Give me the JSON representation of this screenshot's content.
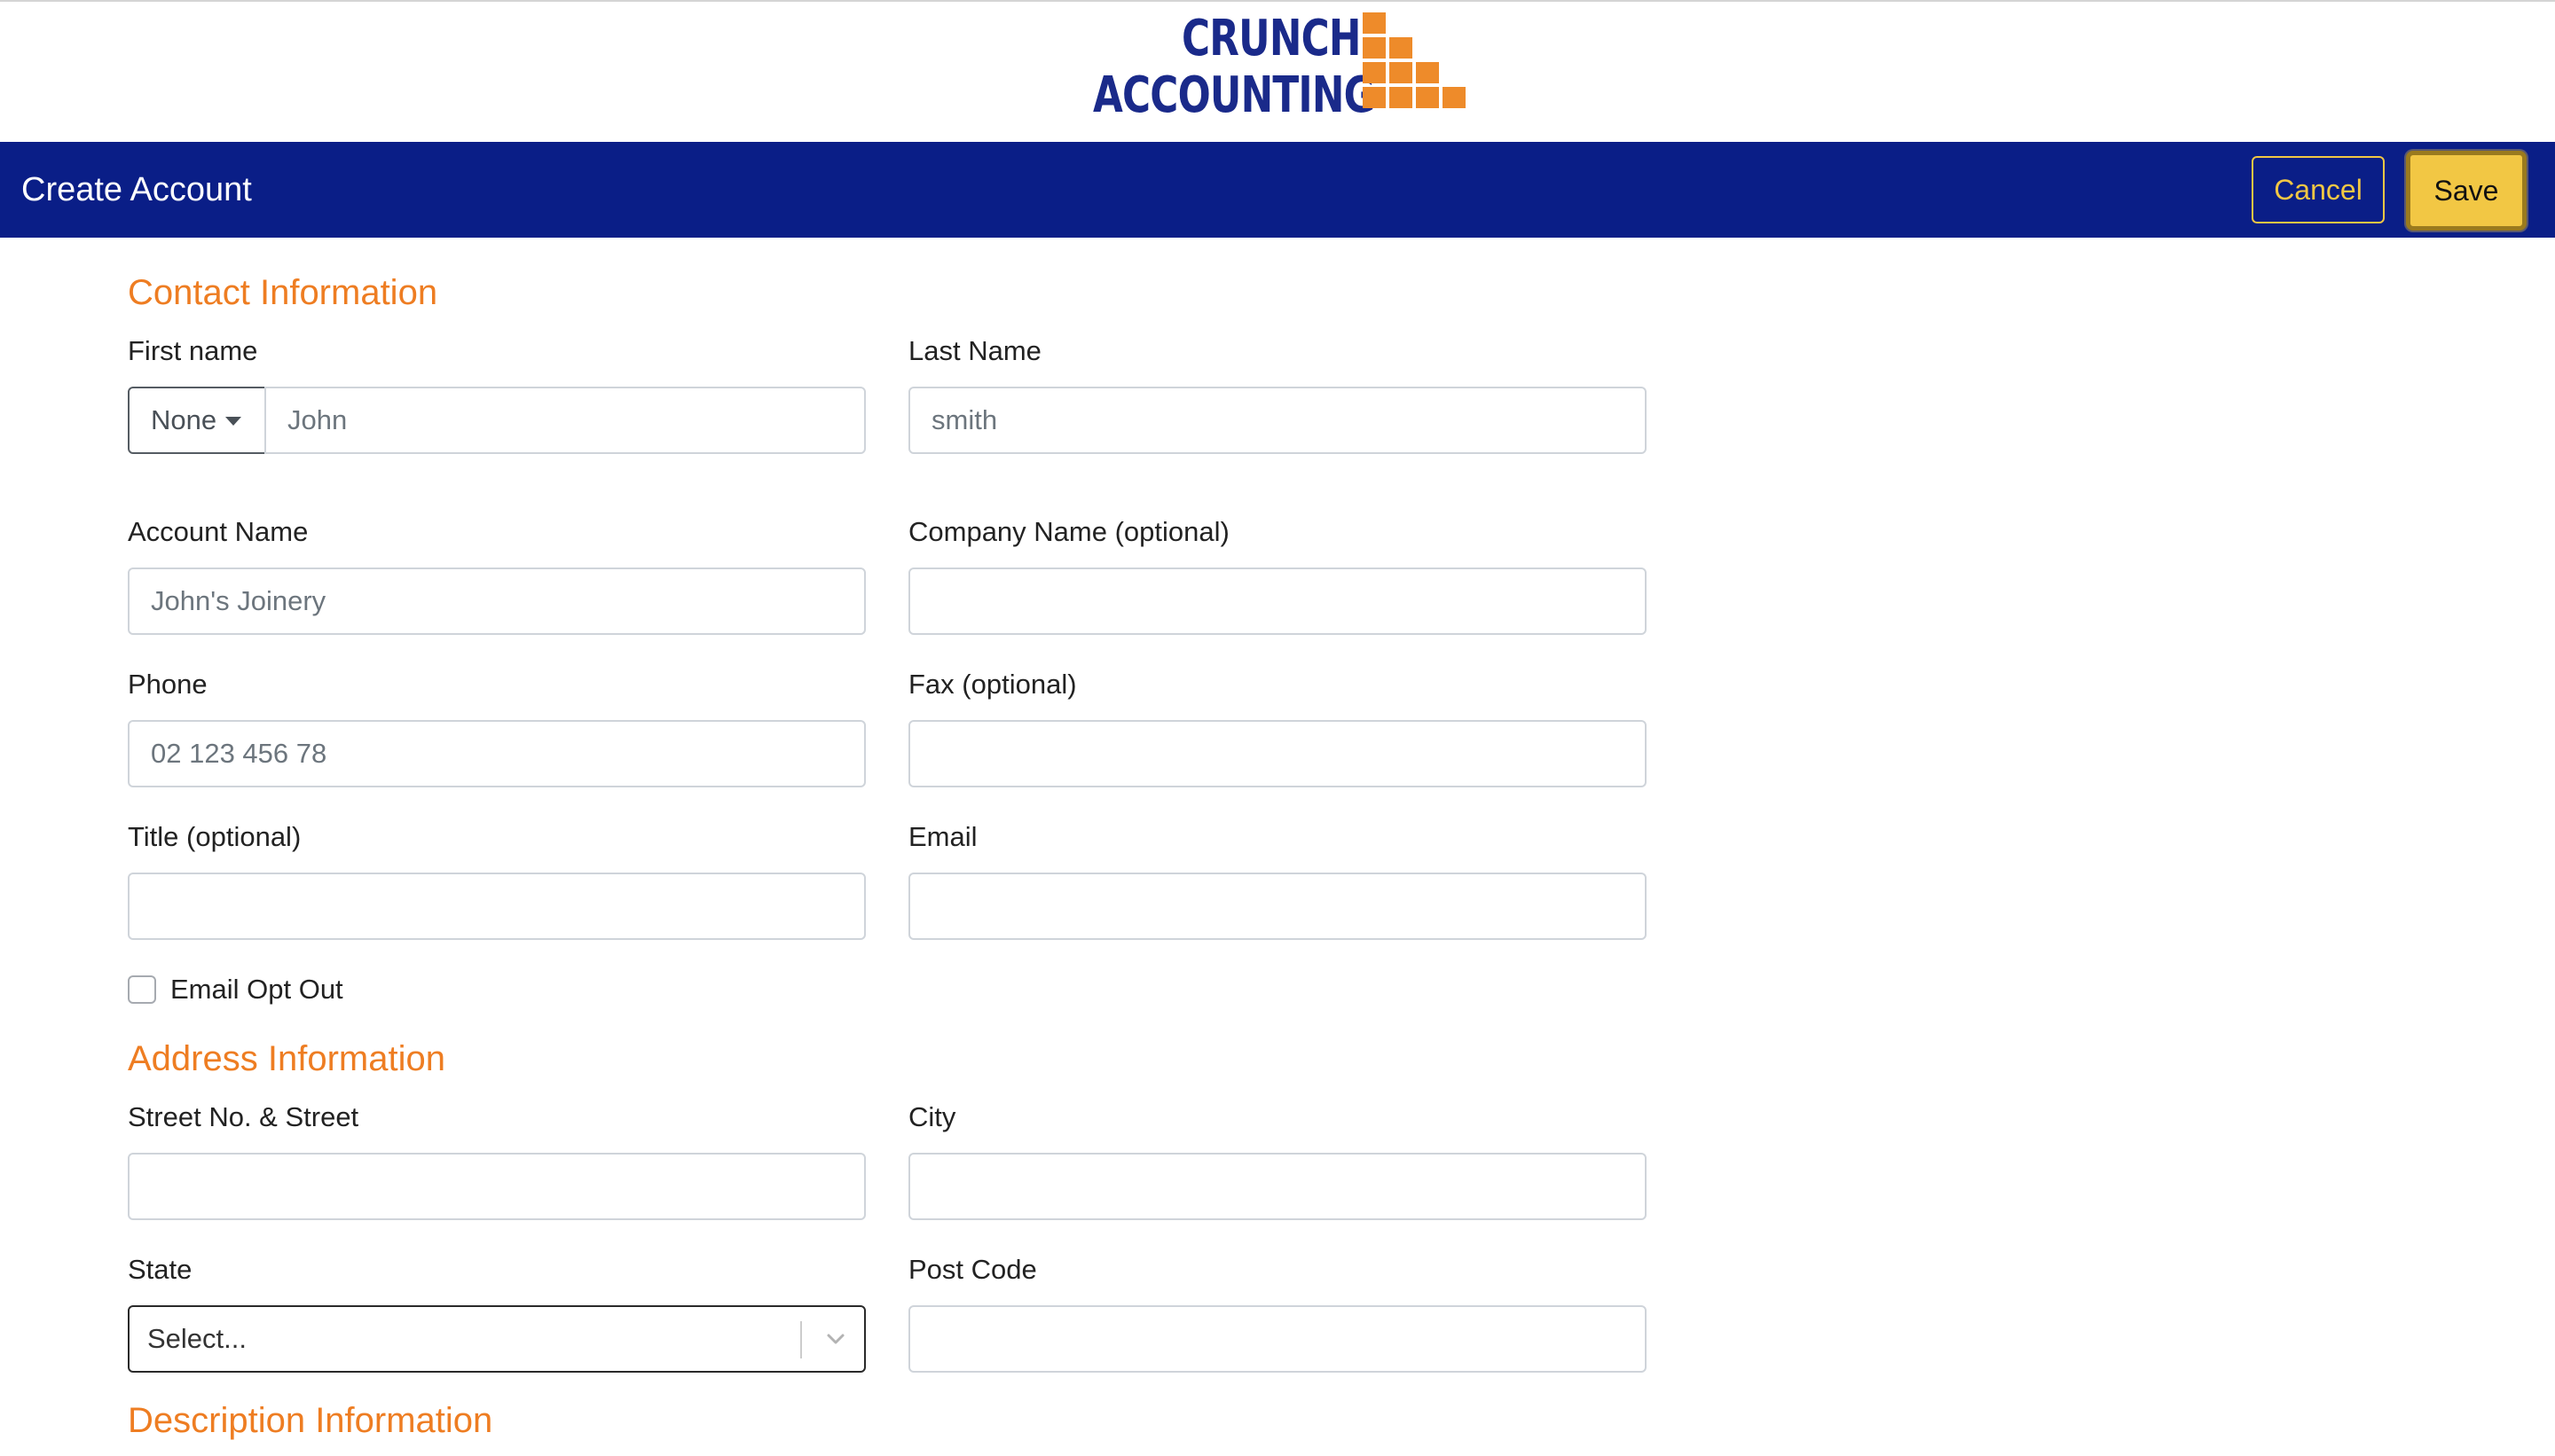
{
  "logo": {
    "line1": "CRUNCH",
    "line2": "ACCOUNTING",
    "text_color": "#1a2a8a",
    "block_color": "#ee8b2a"
  },
  "header": {
    "title": "Create Account",
    "cancel_label": "Cancel",
    "save_label": "Save",
    "background": "#0a1e87",
    "accent": "#f2c744"
  },
  "sections": {
    "contact": "Contact Information",
    "address": "Address Information",
    "description": "Description Information",
    "heading_color": "#ee7d22"
  },
  "contact": {
    "first_name_label": "First name",
    "salutation_value": "None",
    "first_name_value": "John",
    "last_name_label": "Last Name",
    "last_name_value": "smith",
    "account_name_label": "Account Name",
    "account_name_value": "John's Joinery",
    "company_name_label": "Company Name (optional)",
    "company_name_value": "",
    "phone_label": "Phone",
    "phone_value": "02 123 456 78",
    "fax_label": "Fax (optional)",
    "fax_value": "",
    "title_label": "Title (optional)",
    "title_value": "",
    "email_label": "Email",
    "email_value": "",
    "email_opt_out_label": "Email Opt Out",
    "email_opt_out_checked": false
  },
  "address": {
    "street_label": "Street No. & Street",
    "street_value": "",
    "city_label": "City",
    "city_value": "",
    "state_label": "State",
    "state_value": "Select...",
    "postcode_label": "Post Code",
    "postcode_value": ""
  }
}
